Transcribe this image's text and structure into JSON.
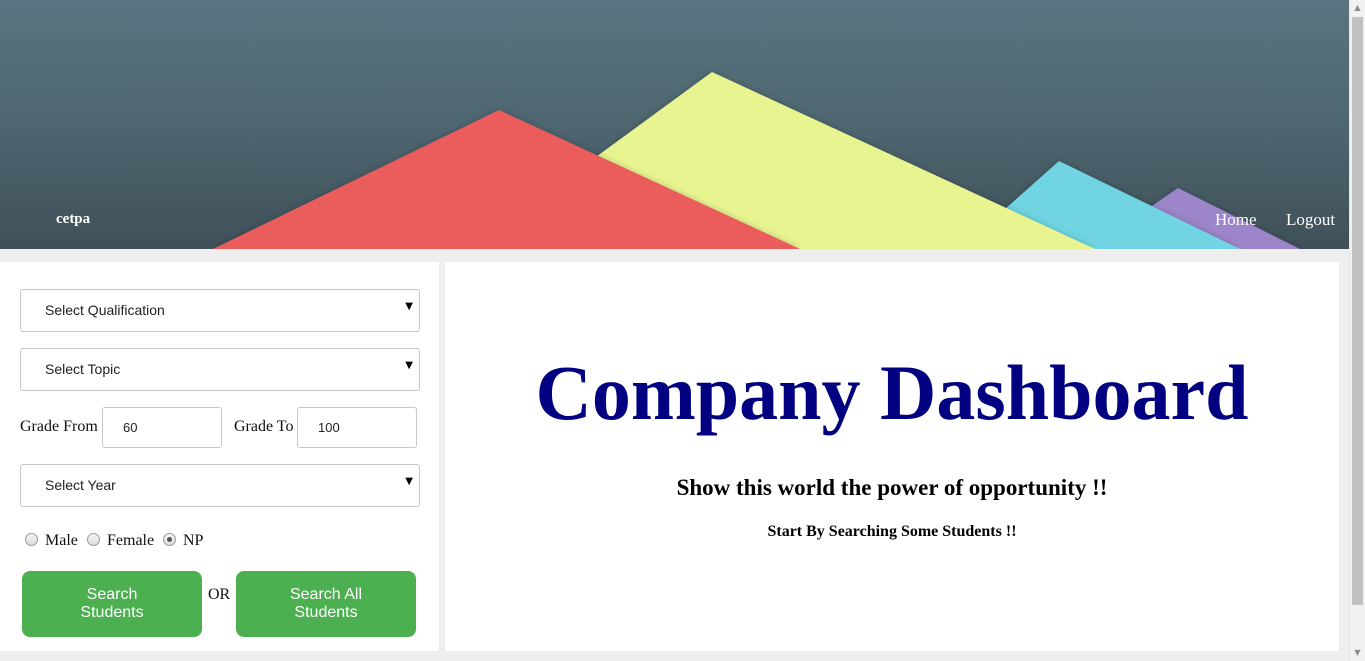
{
  "header": {
    "brand": "cetpa",
    "nav": {
      "home": "Home",
      "logout": "Logout"
    }
  },
  "filters": {
    "qualification": {
      "selected": "Select Qualification"
    },
    "topic": {
      "selected": "Select Topic"
    },
    "grade_from": {
      "label": "Grade From",
      "value": "60"
    },
    "grade_to": {
      "label": "Grade To",
      "value": "100"
    },
    "year": {
      "selected": "Select Year"
    },
    "gender": {
      "options": [
        "Male",
        "Female",
        "NP"
      ],
      "selected": "NP"
    },
    "search_students_label": "Search Students",
    "or_label": "OR",
    "search_all_label": "Search All Students"
  },
  "main": {
    "title": "Company Dashboard",
    "subtitle": "Show this world the power of opportunity !!",
    "hint": "Start By Searching Some Students !!"
  },
  "colors": {
    "header_bg": "#4e6670",
    "red_mountain": "#eb5b5b",
    "yellow_mountain": "#e8f490",
    "cyan_mountain": "#6fd4e2",
    "purple_mountain": "#9c86c9",
    "button_green": "#4caf50",
    "title_navy": "#000080"
  }
}
